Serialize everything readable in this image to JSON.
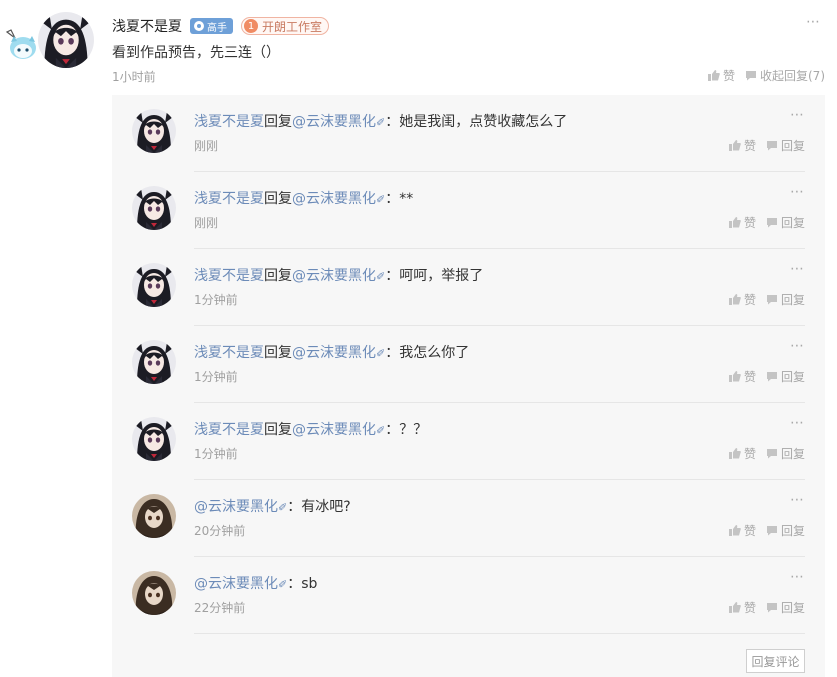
{
  "main_comment": {
    "username": "浅夏不是夏",
    "level_badge": "高手",
    "fan_badge_num": "1",
    "fan_badge_name": "开朗工作室",
    "text": "看到作品预告，先三连（）",
    "time": "1小时前",
    "like_label": "赞",
    "collapse_label": "收起回复(7)",
    "more_icon": "⋯"
  },
  "replies": [
    {
      "user": "浅夏不是夏",
      "reply_word": "回复",
      "target": "@云沫要黑化",
      "sep": "：",
      "text": "她是我闺，点赞收藏怎么了",
      "time": "刚刚",
      "like": "赞",
      "reply": "回复",
      "avatar": "girl"
    },
    {
      "user": "浅夏不是夏",
      "reply_word": "回复",
      "target": "@云沫要黑化",
      "sep": "：",
      "text": "**",
      "time": "刚刚",
      "like": "赞",
      "reply": "回复",
      "avatar": "girl"
    },
    {
      "user": "浅夏不是夏",
      "reply_word": "回复",
      "target": "@云沫要黑化",
      "sep": "：",
      "text": "呵呵，举报了",
      "time": "1分钟前",
      "like": "赞",
      "reply": "回复",
      "avatar": "girl"
    },
    {
      "user": "浅夏不是夏",
      "reply_word": "回复",
      "target": "@云沫要黑化",
      "sep": "：",
      "text": "我怎么你了",
      "time": "1分钟前",
      "like": "赞",
      "reply": "回复",
      "avatar": "girl"
    },
    {
      "user": "浅夏不是夏",
      "reply_word": "回复",
      "target": "@云沫要黑化",
      "sep": "：",
      "text": "？？",
      "time": "1分钟前",
      "like": "赞",
      "reply": "回复",
      "avatar": "girl"
    },
    {
      "user": "",
      "reply_word": "",
      "target": "@云沫要黑化",
      "sep": "：",
      "text": "有冰吧?",
      "time": "20分钟前",
      "like": "赞",
      "reply": "回复",
      "avatar": "brown"
    },
    {
      "user": "",
      "reply_word": "",
      "target": "@云沫要黑化",
      "sep": "：",
      "text": "sb",
      "time": "22分钟前",
      "like": "赞",
      "reply": "回复",
      "avatar": "brown"
    }
  ],
  "reply_comment_button": "回复评论",
  "colors": {
    "link": "#6c8bb8",
    "panel": "#f7f7f7",
    "badge_blue": "#6ea0d8",
    "fan_orange": "#f08b63"
  }
}
